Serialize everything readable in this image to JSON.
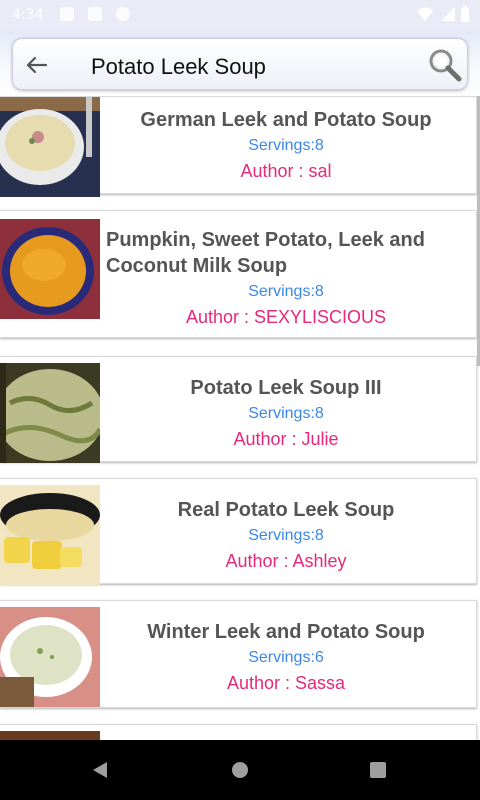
{
  "status_bar": {
    "time": "4:34"
  },
  "search": {
    "query": "Potato Leek Soup"
  },
  "recipes": [
    {
      "title": "German Leek and Potato Soup",
      "servings": "Servings:8",
      "author": "Author : sal"
    },
    {
      "title": "Pumpkin, Sweet Potato, Leek and Coconut Milk Soup",
      "servings": "Servings:8",
      "author": "Author : SEXYLISCIOUS"
    },
    {
      "title": "Potato Leek Soup III",
      "servings": "Servings:8",
      "author": "Author : Julie"
    },
    {
      "title": "Real Potato Leek Soup",
      "servings": "Servings:8",
      "author": "Author : Ashley"
    },
    {
      "title": "Winter Leek and Potato Soup",
      "servings": "Servings:6",
      "author": "Author : Sassa"
    }
  ],
  "icons": {
    "back": "arrow-back-icon",
    "search": "magnifier-icon",
    "nav": [
      "nav-back-icon",
      "nav-home-icon",
      "nav-recents-icon"
    ]
  },
  "colors": {
    "servings": "#3a87e8",
    "author": "#e8287a",
    "title": "#555555"
  }
}
